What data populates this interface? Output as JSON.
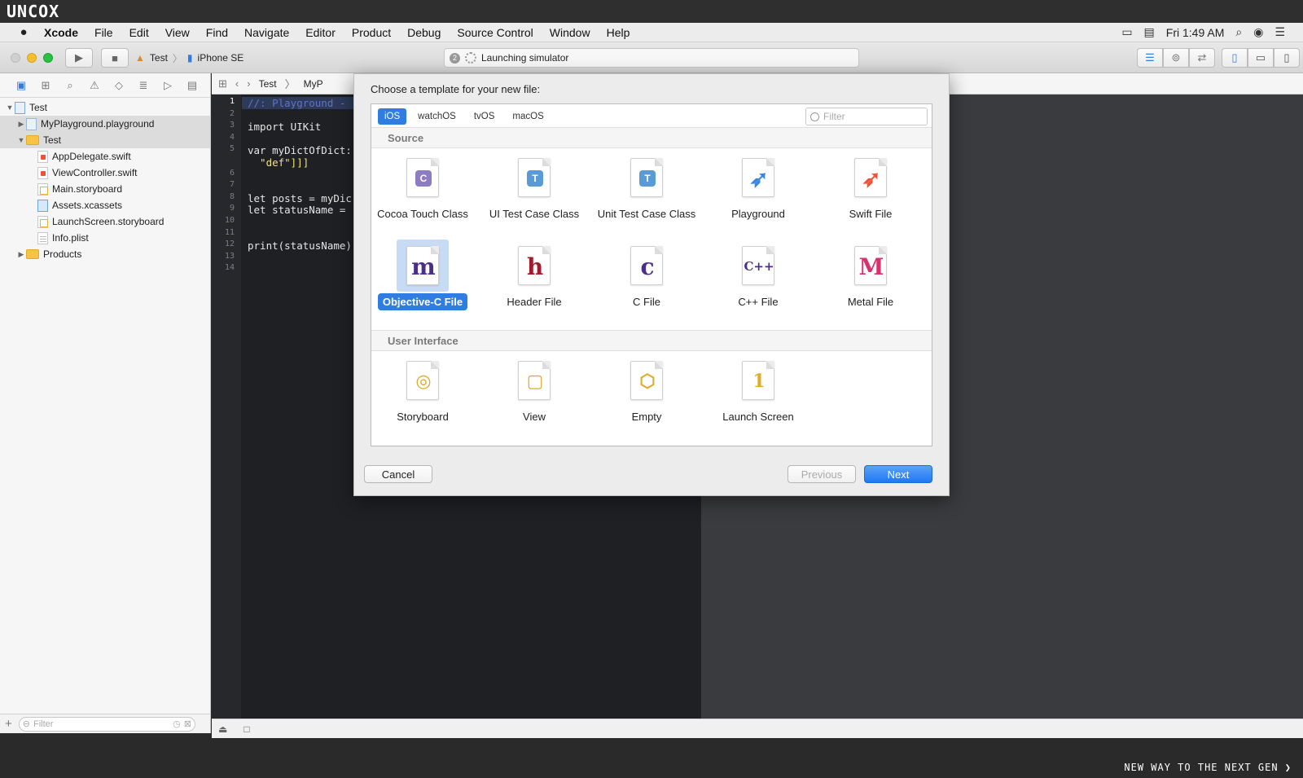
{
  "brand": {
    "logo": "UNCOX",
    "slogan": "NEW WAY TO THE NEXT GEN ❯"
  },
  "menubar": {
    "app_name": "Xcode",
    "items": [
      "File",
      "Edit",
      "View",
      "Find",
      "Navigate",
      "Editor",
      "Product",
      "Debug",
      "Source Control",
      "Window",
      "Help"
    ],
    "clock": "Fri 1:49 AM"
  },
  "toolbar": {
    "scheme": "Test",
    "device": "iPhone SE",
    "activity_badge": "2",
    "activity_text": "Launching simulator"
  },
  "navigator": {
    "tree": [
      {
        "label": "Test",
        "icon": "project-icon",
        "depth": 0,
        "disclosure": "▼",
        "selected": false
      },
      {
        "label": "MyPlayground.playground",
        "icon": "playground-icon",
        "depth": 1,
        "disclosure": "▶",
        "selected": true
      },
      {
        "label": "Test",
        "icon": "folder-icon",
        "depth": 1,
        "disclosure": "▼",
        "selected": true
      },
      {
        "label": "AppDelegate.swift",
        "icon": "swift-file-icon",
        "depth": 2,
        "disclosure": "",
        "selected": false
      },
      {
        "label": "ViewController.swift",
        "icon": "swift-file-icon",
        "depth": 2,
        "disclosure": "",
        "selected": false
      },
      {
        "label": "Main.storyboard",
        "icon": "storyboard-icon",
        "depth": 2,
        "disclosure": "",
        "selected": false
      },
      {
        "label": "Assets.xcassets",
        "icon": "assets-icon",
        "depth": 2,
        "disclosure": "",
        "selected": false
      },
      {
        "label": "LaunchScreen.storyboard",
        "icon": "storyboard-icon",
        "depth": 2,
        "disclosure": "",
        "selected": false
      },
      {
        "label": "Info.plist",
        "icon": "plist-icon",
        "depth": 2,
        "disclosure": "",
        "selected": false
      },
      {
        "label": "Products",
        "icon": "folder-icon",
        "depth": 1,
        "disclosure": "▶",
        "selected": false
      }
    ],
    "filter_placeholder": "Filter"
  },
  "jumpbar": {
    "crumbs": [
      "Test",
      "MyP"
    ]
  },
  "editor": {
    "current_line": 1,
    "lines": [
      {
        "n": "1",
        "text": "//: Playground -",
        "kind": "comment"
      },
      {
        "n": "2",
        "text": "",
        "kind": "plain"
      },
      {
        "n": "3",
        "text": "import UIKit",
        "kind": "plain"
      },
      {
        "n": "4",
        "text": "",
        "kind": "plain"
      },
      {
        "n": "5",
        "text": "var myDictOfDict:",
        "kind": "plain"
      },
      {
        "n": "",
        "text": "  \"def\"]]]",
        "kind": "string"
      },
      {
        "n": "6",
        "text": "",
        "kind": "plain"
      },
      {
        "n": "7",
        "text": "",
        "kind": "plain"
      },
      {
        "n": "8",
        "text": "let posts = myDic",
        "kind": "plain"
      },
      {
        "n": "9",
        "text": "let statusName =",
        "kind": "plain"
      },
      {
        "n": "10",
        "text": "",
        "kind": "plain"
      },
      {
        "n": "11",
        "text": "",
        "kind": "plain"
      },
      {
        "n": "12",
        "text": "print(statusName)",
        "kind": "plain"
      },
      {
        "n": "13",
        "text": "",
        "kind": "plain"
      },
      {
        "n": "14",
        "text": "",
        "kind": "plain"
      }
    ]
  },
  "sheet": {
    "title": "Choose a template for your new file:",
    "platforms": [
      {
        "label": "iOS",
        "active": true
      },
      {
        "label": "watchOS",
        "active": false
      },
      {
        "label": "tvOS",
        "active": false
      },
      {
        "label": "macOS",
        "active": false
      }
    ],
    "filter_placeholder": "Filter",
    "sections": [
      {
        "title": "Source",
        "templates": [
          {
            "label": "Cocoa Touch Class",
            "icon": "cocoa-touch-class-icon",
            "glyph": "C",
            "color": "#8e7cc3"
          },
          {
            "label": "UI Test Case Class",
            "icon": "ui-test-case-icon",
            "glyph": "T",
            "color": "#5b9bd5"
          },
          {
            "label": "Unit Test Case Class",
            "icon": "unit-test-case-icon",
            "glyph": "T",
            "color": "#5b9bd5"
          },
          {
            "label": "Playground",
            "icon": "playground-swift-icon",
            "glyph": "➶",
            "color": "#3a86e0"
          },
          {
            "label": "Swift File",
            "icon": "swift-icon",
            "glyph": "➶",
            "color": "#f05138"
          },
          {
            "label": "Objective-C File",
            "icon": "objc-file-icon",
            "glyph": "m",
            "color": "#4a2f8a",
            "selected": true
          },
          {
            "label": "Header File",
            "icon": "header-file-icon",
            "glyph": "h",
            "color": "#a01c2c"
          },
          {
            "label": "C File",
            "icon": "c-file-icon",
            "glyph": "c",
            "color": "#4a2f8a"
          },
          {
            "label": "C++ File",
            "icon": "cpp-file-icon",
            "glyph": "C++",
            "color": "#4a2f8a"
          },
          {
            "label": "Metal File",
            "icon": "metal-file-icon",
            "glyph": "M",
            "color": "#d6336c"
          }
        ]
      },
      {
        "title": "User Interface",
        "templates": [
          {
            "label": "Storyboard",
            "icon": "storyboard-template-icon",
            "glyph": "◎",
            "color": "#e2a92b"
          },
          {
            "label": "View",
            "icon": "view-template-icon",
            "glyph": "▢",
            "color": "#e2a92b"
          },
          {
            "label": "Empty",
            "icon": "empty-template-icon",
            "glyph": "⬡",
            "color": "#e2a92b"
          },
          {
            "label": "Launch Screen",
            "icon": "launch-screen-icon",
            "glyph": "1",
            "color": "#e2a92b"
          }
        ]
      }
    ],
    "buttons": {
      "cancel": "Cancel",
      "previous": "Previous",
      "next": "Next"
    }
  }
}
